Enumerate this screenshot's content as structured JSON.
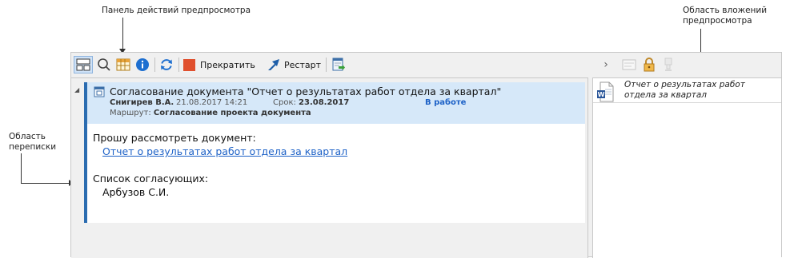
{
  "callouts": {
    "toolbar_label": "Панель действий предпросмотра",
    "attachments_label_line1": "Область вложений",
    "attachments_label_line2": "предпросмотра",
    "correspondence_label_line1": "Область",
    "correspondence_label_line2": "переписки"
  },
  "toolbar": {
    "stop_label": "Прекратить",
    "restart_label": "Рестарт",
    "nav_chevron": "›"
  },
  "message": {
    "collapse_glyph": "◢",
    "subject": "Согласование документа \"Отчет о результатах работ отдела за квартал\"",
    "author": "Снигирев В.А.",
    "date": "21.08.2017 14:21",
    "deadline_label": "Срок:",
    "deadline": "23.08.2017",
    "status": "В работе",
    "route_label": "Маршрут:",
    "route": "Согласование проекта документа",
    "request": "Прошу рассмотреть документ:",
    "document_link": "Отчет о результатах работ отдела за квартал",
    "approvers_label": "Список согласующих:",
    "approver": "Арбузов С.И."
  },
  "attachment": {
    "name_line1": "Отчет о результатах работ",
    "name_line2": "отдела за квартал",
    "icon": "word-document-icon"
  },
  "colors": {
    "accent": "#2b6cb0",
    "header_bg": "#d6e8f9",
    "stop_red": "#e0502e",
    "link": "#1e62c7"
  }
}
